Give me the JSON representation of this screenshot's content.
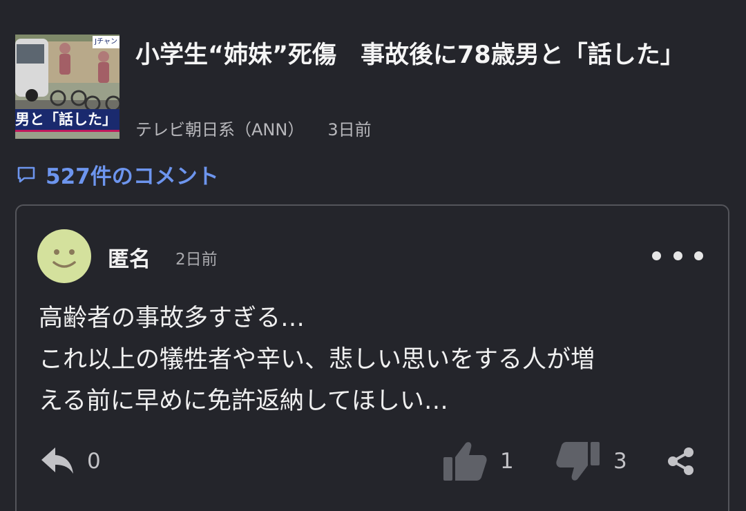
{
  "article": {
    "thumbnail": {
      "caption": "男と「話した」",
      "logo": "Jチャン"
    },
    "headline": "小学生“姉妹”死傷　事故後に78歳男と「話した」",
    "source": "テレビ朝日系（ANN）",
    "time": "3日前"
  },
  "comments_link": {
    "icon": "comment-bubble-icon",
    "label": "527件のコメント"
  },
  "comment": {
    "avatar": "smiley-face-avatar",
    "author": "匿名",
    "posted": "2日前",
    "menu_icon": "more-dots-icon",
    "lines": [
      "高齢者の事故多すぎる…",
      "これ以上の犠牲者や辛い、悲しい思いをする人が増",
      "える前に早めに免許返納してほしい…"
    ],
    "actions": {
      "reply": {
        "icon": "reply-icon",
        "count": "0"
      },
      "like": {
        "icon": "thumbs-up-icon",
        "count": "1"
      },
      "dislike": {
        "icon": "thumbs-down-icon",
        "count": "3"
      },
      "share": {
        "icon": "share-icon"
      }
    }
  },
  "colors": {
    "background": "#24252b",
    "link_blue": "#6d95ee",
    "card_border": "#54555b",
    "avatar": "#d4e19d",
    "muted_text": "#b8b8bc",
    "icon_gray": "#5f6168"
  }
}
